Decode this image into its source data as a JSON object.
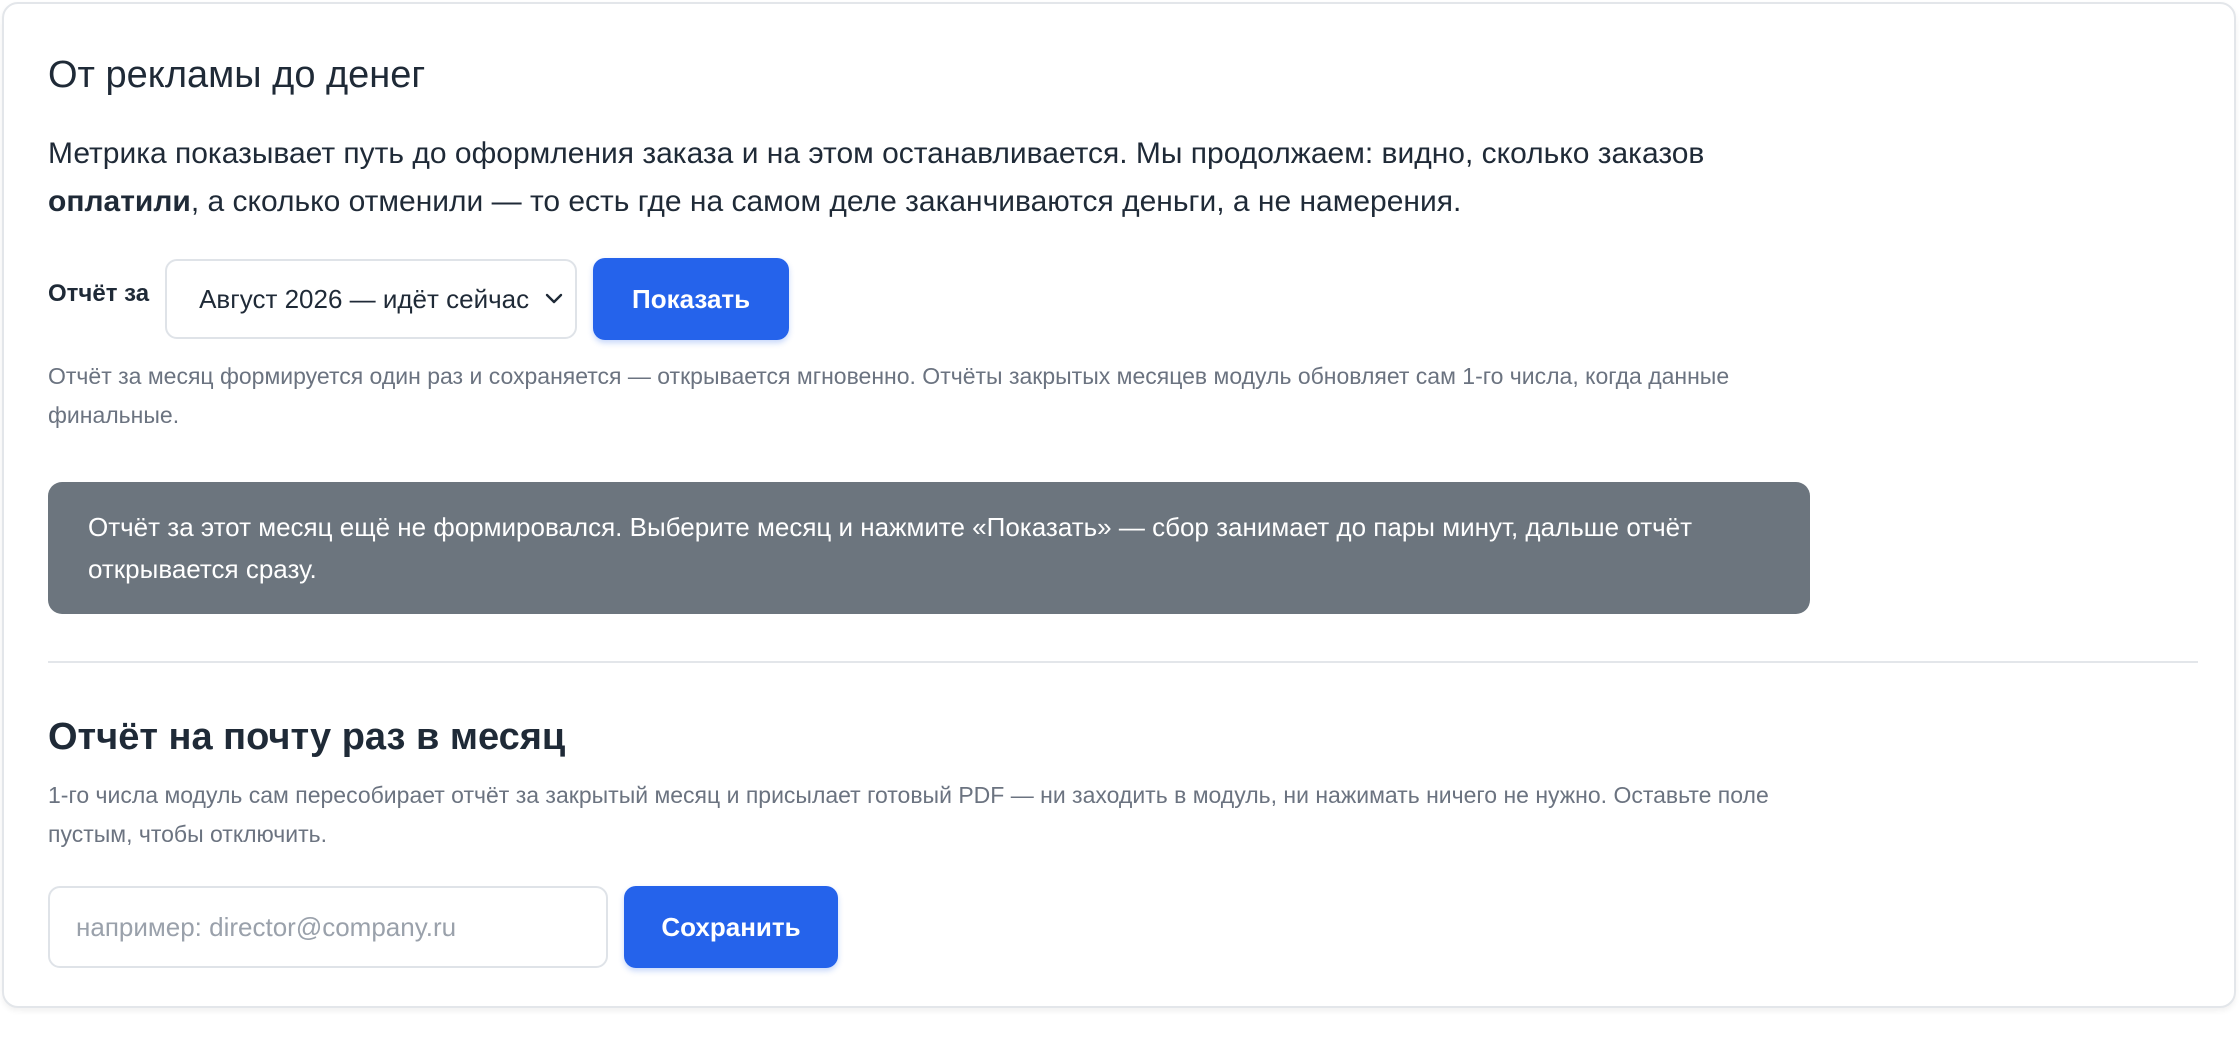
{
  "report": {
    "title": "От рекламы до денег",
    "lead_part1": "Метрика показывает путь до оформления заказа и на этом останавливается. Мы продолжаем: видно, сколько заказов ",
    "lead_bold": "оплатили",
    "lead_part2": ", а сколько отменили — то есть где на самом деле заканчиваются деньги, а не намерения.",
    "period_label": "Отчёт за",
    "period_selected": "Август 2026 — идёт сейчас",
    "show_button": "Показать",
    "hint": "Отчёт за месяц формируется один раз и сохраняется — открывается мгновенно. Отчёты закрытых месяцев модуль обновляет сам 1-го числа, когда данные финальные.",
    "notice": "Отчёт за этот месяц ещё не формировался. Выберите месяц и нажмите «Показать» — сбор занимает до пары минут, дальше отчёт открывается сразу."
  },
  "email_report": {
    "title": "Отчёт на почту раз в месяц",
    "hint": "1-го числа модуль сам пересобирает отчёт за закрытый месяц и присылает готовый PDF — ни заходить в модуль, ни нажимать ничего не нужно. Оставьте поле пустым, чтобы отключить.",
    "email_value": "",
    "email_placeholder": "например: director@company.ru",
    "save_button": "Сохранить"
  },
  "colors": {
    "accent": "#2563eb",
    "notice_bg": "#6c757e",
    "muted_text": "#6b7380"
  },
  "icons": {
    "select_chevron": "chevron-down-icon"
  }
}
